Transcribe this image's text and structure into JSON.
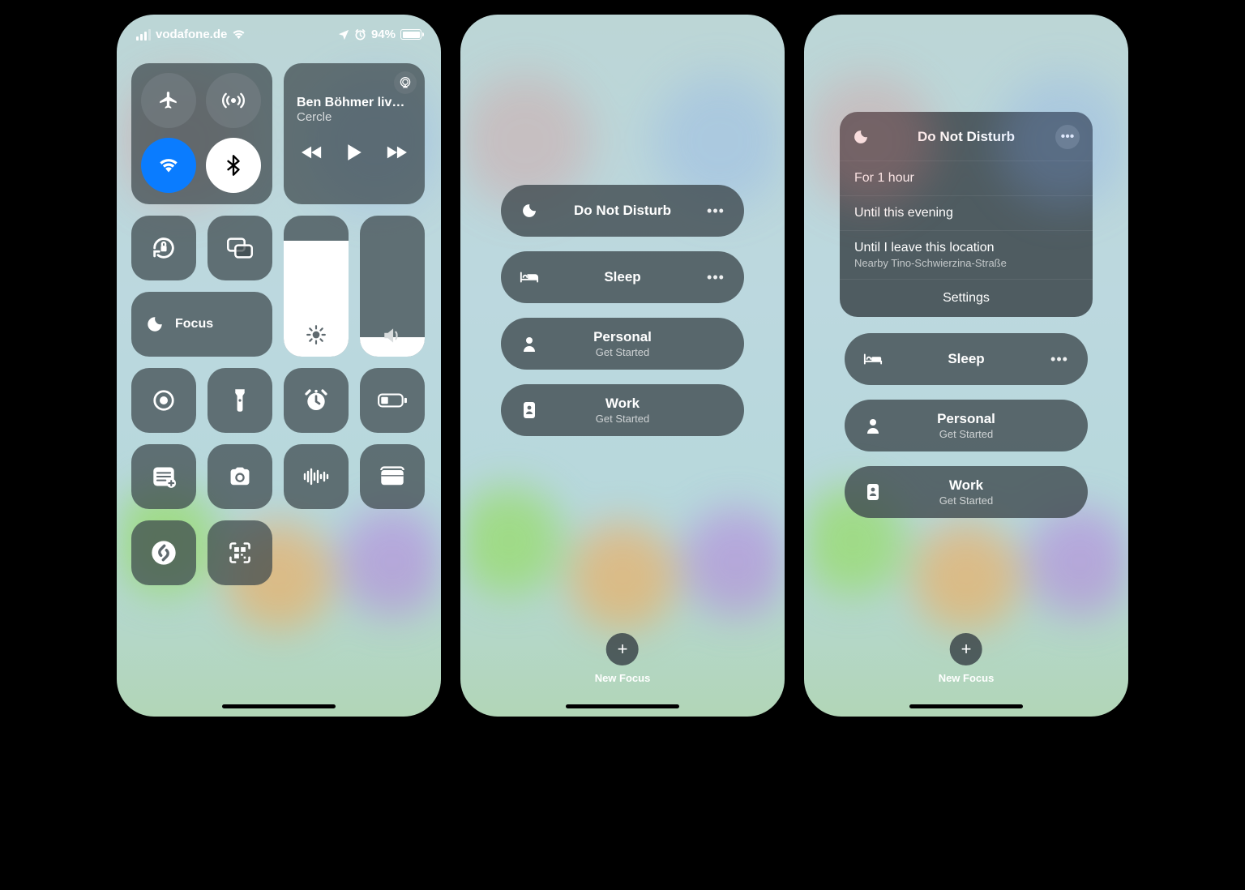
{
  "status": {
    "carrier": "vodafone.de",
    "battery_pct": "94%"
  },
  "media": {
    "title": "Ben Böhmer liv…",
    "subtitle": "Cercle"
  },
  "focus_tile": "Focus",
  "focus_menu": {
    "dnd": "Do Not Disturb",
    "sleep": "Sleep",
    "personal": "Personal",
    "work": "Work",
    "get_started": "Get Started",
    "new_focus": "New Focus"
  },
  "dnd_card": {
    "title": "Do Not Disturb",
    "opt1": "For 1 hour",
    "opt2": "Until this evening",
    "opt3": "Until I leave this location",
    "opt3_sub": "Nearby Tino-Schwierzina-Straße",
    "settings": "Settings"
  }
}
